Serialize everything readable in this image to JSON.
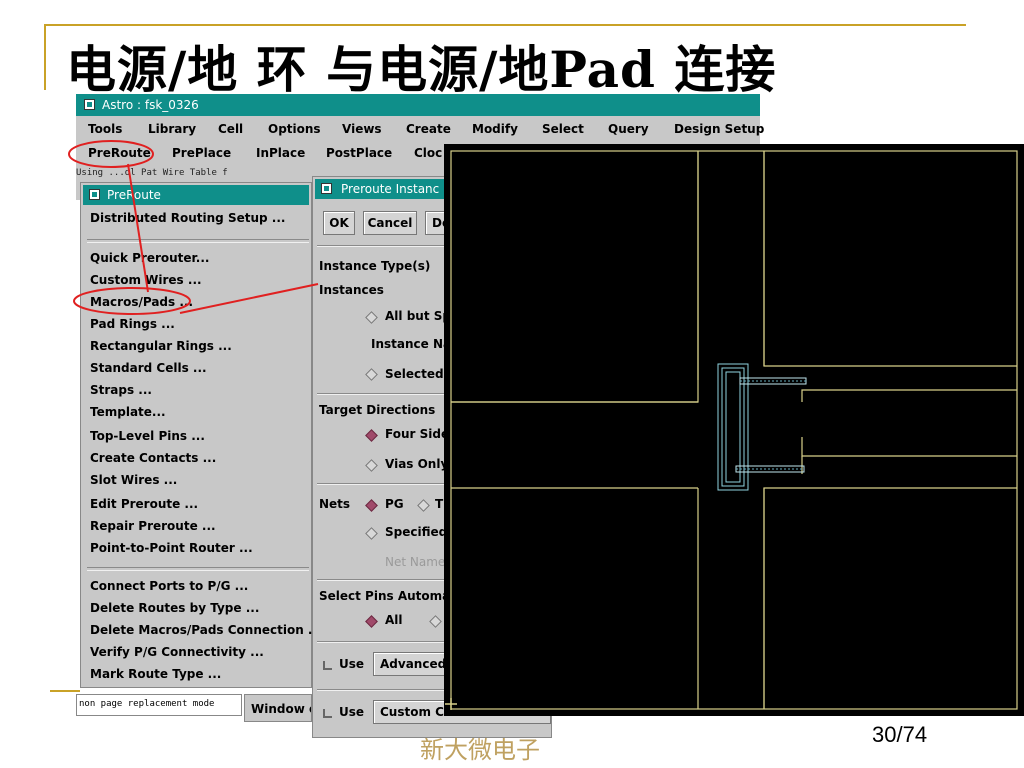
{
  "slide": {
    "title": "电源/地 环 与电源/地Pad 连接",
    "page_number": "30/74",
    "footer": "新大微电子"
  },
  "astro": {
    "title": "Astro : fsk_0326",
    "menu": [
      "Tools",
      "Library",
      "Cell",
      "Options",
      "Views",
      "Create",
      "Modify",
      "Select",
      "Query",
      "Design Setup"
    ],
    "toolbar": [
      "PreRoute",
      "PrePlace",
      "InPlace",
      "PostPlace",
      "Cloc"
    ],
    "command_line": "Using ...dl Pat Wire Table f"
  },
  "preroute_menu": {
    "title": "PreRoute",
    "group1": [
      "Distributed Routing Setup ..."
    ],
    "group2": [
      "Quick Prerouter...",
      "Custom Wires ...",
      "Macros/Pads ...",
      "Pad Rings ...",
      "Rectangular Rings ...",
      "Standard Cells ...",
      "Straps ...",
      "Template...",
      "Top-Level Pins ...",
      "Create Contacts ...",
      "Slot Wires ...",
      "Edit Preroute ...",
      "Repair Preroute ...",
      "Point-to-Point Router ..."
    ],
    "group3": [
      "Connect Ports to P/G ...",
      "Delete Routes by Type ...",
      "Delete Macros/Pads Connection ...",
      "Verify P/G Connectivity ...",
      "Mark Route Type ..."
    ]
  },
  "dialog": {
    "title": "Preroute Instanc",
    "ok": "OK",
    "cancel": "Cancel",
    "default": "De",
    "instance_types": "Instance Type(s)",
    "instances": "Instances",
    "all_but": "All but Sp",
    "instance_name": "Instance Na",
    "selected": "Selected",
    "target_directions": "Target Directions",
    "four_sides": "Four Side",
    "vias_only": "Vias Only",
    "nets": "Nets",
    "pg": "PG",
    "t": "T",
    "specified": "Specified",
    "net_name": "Net Name(s",
    "select_pins": "Select Pins Automat",
    "all": "All",
    "use1": "Use",
    "advanced": "Advanced",
    "use2": "Use",
    "custom": "Custom Connection Rules"
  },
  "status": {
    "mode": "non page replacement mode",
    "window_tab": "Window o"
  },
  "colors": {
    "titlebar": "#0f8f8a",
    "panel": "#c8c8c8",
    "layout_bg": "#000000",
    "layout_lines": "#d8d08a",
    "macro": "#8fd4e0",
    "annotation": "#e02020",
    "slide_accent": "#c9a227"
  },
  "icons": {
    "window": "window-icon",
    "radio_on": "radio-selected-icon",
    "radio_off": "radio-unselected-icon",
    "check": "checkbox-icon"
  }
}
